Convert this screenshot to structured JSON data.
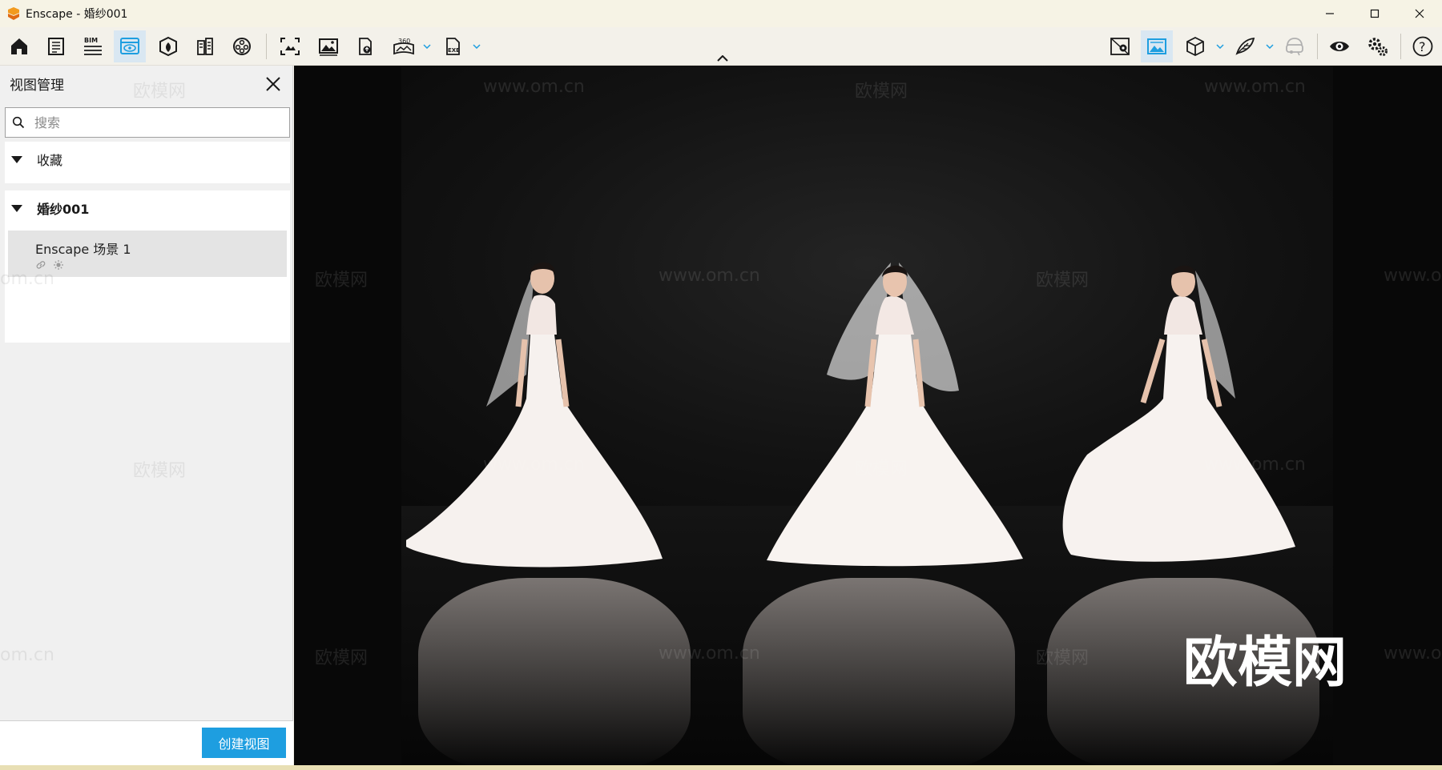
{
  "window": {
    "title": "Enscape - 婚纱001",
    "minimize_icon": "minimize-icon",
    "maximize_icon": "maximize-icon",
    "close_icon": "close-icon"
  },
  "toolbar": {
    "left_buttons": [
      "home-icon",
      "news-icon",
      "bim-icon",
      "view-management-icon",
      "asset-library-icon",
      "material-editor-icon",
      "video-editor-icon",
      "screenshot-icon",
      "batch-render-icon",
      "panorama-icon",
      "360-panorama-icon",
      "exe-export-icon"
    ],
    "bim_label": "BIM",
    "pano_label": "360",
    "exe_label": "EXE",
    "right_buttons": [
      "map-icon",
      "image-mode-icon",
      "cube-icon",
      "feather-icon",
      "vr-headset-icon",
      "eye-icon",
      "settings-icon",
      "help-icon"
    ],
    "help_label": "?"
  },
  "panel": {
    "title": "视图管理",
    "search_placeholder": "搜索",
    "groups": [
      {
        "label": "收藏"
      },
      {
        "label": "婚纱001"
      }
    ],
    "views": [
      {
        "name": "Enscape 场景 1",
        "icons": [
          "link-icon",
          "sun-icon"
        ]
      }
    ],
    "create_button": "创建视图"
  },
  "viewport": {
    "watermark_small": "欧模网",
    "watermark_url": "www.om.cn",
    "watermark_partial_url": "om.cn",
    "watermark_right_partial": "www.o",
    "watermark_big": "欧模网"
  },
  "colors": {
    "accent": "#1e9ee0",
    "titlebar": "#f6f3e5",
    "toolbar": "#f3f1ea"
  }
}
